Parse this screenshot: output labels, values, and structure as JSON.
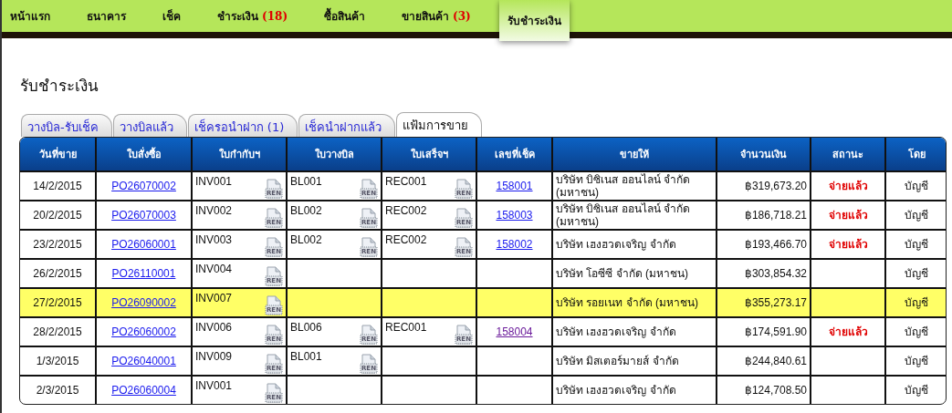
{
  "nav": [
    {
      "label": "หน้าแรก",
      "selected": false
    },
    {
      "label": "ธนาคาร",
      "selected": false
    },
    {
      "label": "เช็ค",
      "selected": false
    },
    {
      "label": "ชำระเงิน",
      "count": "(18)",
      "selected": false
    },
    {
      "label": "ซื้อสินค้า",
      "selected": false
    },
    {
      "label": "ขายสินค้า",
      "count": "(3)",
      "selected": false
    },
    {
      "label": "รับชำระเงิน",
      "selected": true
    }
  ],
  "page_title": "รับชำระเงิน",
  "tabs": [
    {
      "label": "วางบิล-รับเช็ค",
      "selected": false
    },
    {
      "label": "วางบิลแล้ว",
      "selected": false
    },
    {
      "label": "เช็ครอนำฝาก (1)",
      "selected": false
    },
    {
      "label": "เช็คนำฝากแล้ว",
      "selected": false
    },
    {
      "label": "แฟ้มการขาย",
      "selected": true
    }
  ],
  "table": {
    "columns": [
      "วันที่ขาย",
      "ใบสั่งซื้อ",
      "ใบกำกับฯ",
      "ใบวางบิล",
      "ใบเสร็จฯ",
      "เลขที่เช็ค",
      "ขายให้",
      "จำนวนเงิน",
      "สถานะ",
      "โดย"
    ],
    "rows": [
      {
        "date": "14/2/2015",
        "po": "PO26070002",
        "invoice": {
          "number": "INV001",
          "icon": "REN"
        },
        "bill": {
          "number": "BL001",
          "icon": "REN"
        },
        "receipt": {
          "number": "REC001",
          "icon": "REN"
        },
        "check": {
          "number": "158001",
          "visited": false
        },
        "buyer": "บริษัท บิซิเนส ออนไลน์ จำกัด (มหาชน)",
        "amount": "฿319,673.20",
        "status": "จ่ายแล้ว",
        "by": "บัญชี",
        "highlighted": false
      },
      {
        "date": "20/2/2015",
        "po": "PO26070003",
        "invoice": {
          "number": "INV002",
          "icon": "REN"
        },
        "bill": {
          "number": "BL002",
          "icon": "REN"
        },
        "receipt": {
          "number": "REC002",
          "icon": "REN"
        },
        "check": {
          "number": "158003",
          "visited": false
        },
        "buyer": "บริษัท บิซิเนส ออนไลน์ จำกัด (มหาชน)",
        "amount": "฿186,718.21",
        "status": "จ่ายแล้ว",
        "by": "บัญชี",
        "highlighted": false
      },
      {
        "date": "23/2/2015",
        "po": "PO26060001",
        "invoice": {
          "number": "INV003",
          "icon": "REN"
        },
        "bill": {
          "number": "BL002",
          "icon": "REN"
        },
        "receipt": {
          "number": "REC002",
          "icon": "REN"
        },
        "check": {
          "number": "158002",
          "visited": false
        },
        "buyer": "บริษัท เฮงฮวดเจริญ จำกัด",
        "amount": "฿193,466.70",
        "status": "จ่ายแล้ว",
        "by": "บัญชี",
        "highlighted": false
      },
      {
        "date": "26/2/2015",
        "po": "PO26110001",
        "invoice": {
          "number": "INV004",
          "icon": "REN"
        },
        "buyer": "บริษัท โอซีซี จำกัด (มหาชน)",
        "amount": "฿303,854.32",
        "by": "บัญชี",
        "highlighted": false
      },
      {
        "date": "27/2/2015",
        "po": "PO26090002",
        "invoice": {
          "number": "INV007",
          "icon": "REN"
        },
        "buyer": "บริษัท รอยเนท จำกัด (มหาชน)",
        "amount": "฿355,273.17",
        "by": "บัญชี",
        "highlighted": true
      },
      {
        "date": "28/2/2015",
        "po": "PO26060002",
        "invoice": {
          "number": "INV006",
          "icon": "REN"
        },
        "bill": {
          "number": "BL006",
          "icon": "REN"
        },
        "receipt": {
          "number": "REC001",
          "icon": "REN"
        },
        "check": {
          "number": "158004",
          "visited": true
        },
        "buyer": "บริษัท เฮงฮวดเจริญ จำกัด",
        "amount": "฿174,591.90",
        "status": "จ่ายแล้ว",
        "by": "บัญชี",
        "highlighted": false
      },
      {
        "date": "1/3/2015",
        "po": "PO26040001",
        "invoice": {
          "number": "INV009",
          "icon": "REN"
        },
        "bill": {
          "number": "BL001",
          "icon": "REN"
        },
        "buyer": "บริษัท มิสเตอร์มายส์ จำกัด",
        "amount": "฿244,840.61",
        "by": "บัญชี",
        "highlighted": false
      },
      {
        "date": "2/3/2015",
        "po": "PO26060004",
        "invoice": {
          "number": "INV001",
          "icon": "REN"
        },
        "buyer": "บริษัท เฮงฮวดเจริญ จำกัด",
        "amount": "฿124,708.50",
        "by": "บัญชี",
        "highlighted": false
      }
    ]
  }
}
